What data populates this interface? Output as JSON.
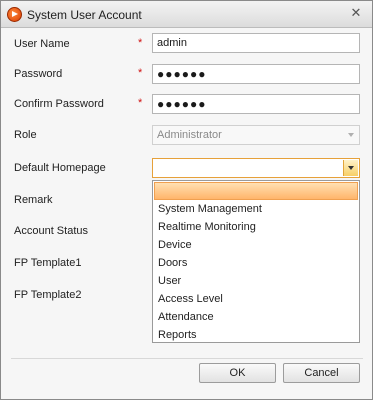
{
  "window": {
    "title": "System User Account",
    "close_glyph": "✕"
  },
  "form": {
    "user_name": {
      "label": "User Name",
      "required_mark": "*",
      "value": "admin"
    },
    "password": {
      "label": "Password",
      "required_mark": "*",
      "value": "●●●●●●"
    },
    "confirm_password": {
      "label": "Confirm Password",
      "required_mark": "*",
      "value": "●●●●●●"
    },
    "role": {
      "label": "Role",
      "value": "Administrator"
    },
    "default_homepage": {
      "label": "Default Homepage",
      "value": ""
    },
    "remark": {
      "label": "Remark"
    },
    "account_status": {
      "label": "Account Status"
    },
    "fp_template1": {
      "label": "FP Template1"
    },
    "fp_template2": {
      "label": "FP Template2"
    }
  },
  "homepage_options": [
    "",
    "System Management",
    "Realtime Monitoring",
    "Device",
    "Doors",
    "User",
    "Access Level",
    "Attendance",
    "Reports"
  ],
  "buttons": {
    "ok": "OK",
    "cancel": "Cancel"
  }
}
